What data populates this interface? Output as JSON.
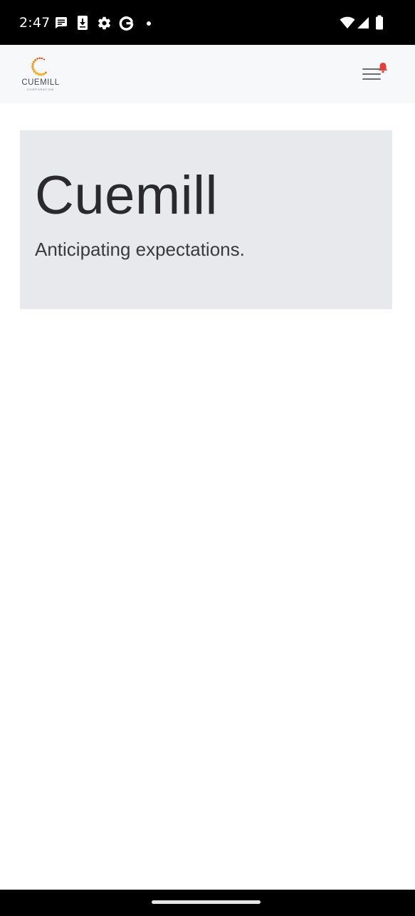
{
  "status_bar": {
    "time": "2:47",
    "notification_icons": [
      "message-icon",
      "download-icon",
      "settings-icon",
      "google-icon",
      "dot-icon"
    ],
    "system_icons": [
      "wifi-icon",
      "cellular-signal-icon",
      "battery-icon"
    ]
  },
  "header": {
    "logo_text": "CUEMILL",
    "logo_subtext": "CORPORATION",
    "menu_icon": "hamburger-menu-icon",
    "notification_badge_icon": "bell-icon"
  },
  "hero": {
    "title": "Cuemill",
    "tagline": "Anticipating expectations."
  },
  "colors": {
    "status_bar_bg": "#000000",
    "header_bg": "#f7f8fa",
    "hero_bg": "#e8e9ed",
    "title_text": "#2a2a2e",
    "logo_orange": "#e8892b",
    "logo_red": "#d9442e",
    "logo_gold": "#f0b43a",
    "bell_red": "#e0413a"
  }
}
